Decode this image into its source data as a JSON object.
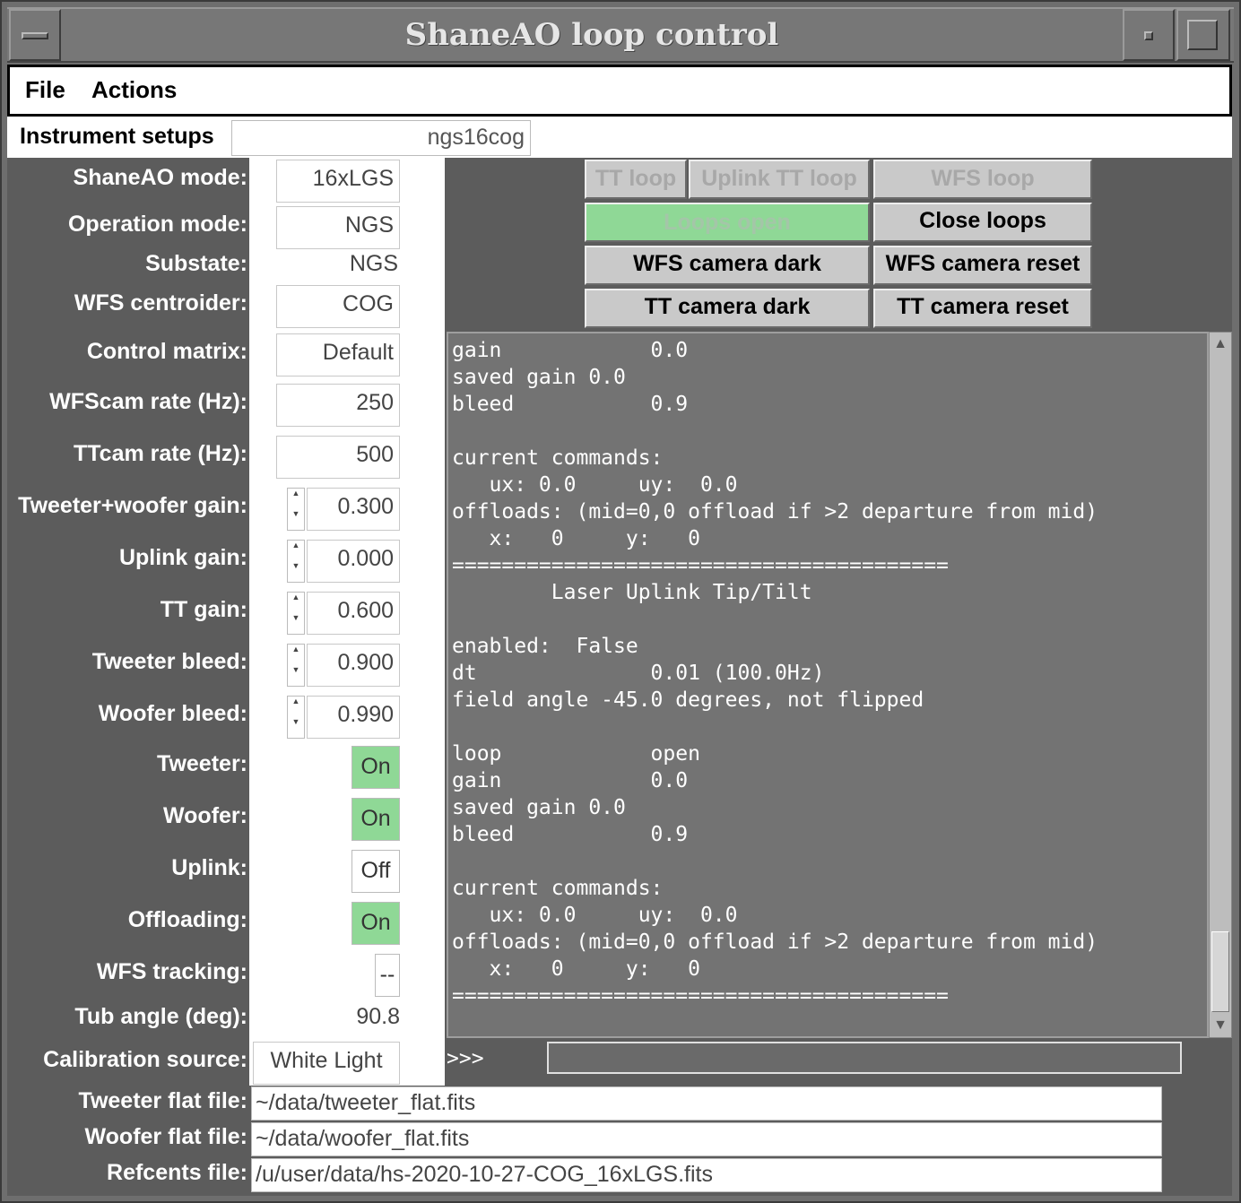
{
  "window": {
    "title": "ShaneAO loop control"
  },
  "menu": {
    "file": "File",
    "actions": "Actions"
  },
  "setups": {
    "label": "Instrument setups",
    "value": "ngs16cog"
  },
  "params": {
    "shaneao_mode": {
      "label": "ShaneAO mode:",
      "value": "16xLGS"
    },
    "operation_mode": {
      "label": "Operation mode:",
      "value": "NGS"
    },
    "substate": {
      "label": "Substate:",
      "value": "NGS"
    },
    "wfs_centroider": {
      "label": "WFS centroider:",
      "value": "COG"
    },
    "control_matrix": {
      "label": "Control matrix:",
      "value": "Default"
    },
    "wfscam_rate": {
      "label": "WFScam rate (Hz):",
      "value": "250"
    },
    "ttcam_rate": {
      "label": "TTcam rate (Hz):",
      "value": "500"
    },
    "tw_gain": {
      "label": "Tweeter+woofer gain:",
      "value": "0.300"
    },
    "uplink_gain": {
      "label": "Uplink gain:",
      "value": "0.000"
    },
    "tt_gain": {
      "label": "TT gain:",
      "value": "0.600"
    },
    "tweeter_bleed": {
      "label": "Tweeter bleed:",
      "value": "0.900"
    },
    "woofer_bleed": {
      "label": "Woofer bleed:",
      "value": "0.990"
    },
    "tweeter": {
      "label": "Tweeter:",
      "value": "On",
      "state": "on"
    },
    "woofer": {
      "label": "Woofer:",
      "value": "On",
      "state": "on"
    },
    "uplink": {
      "label": "Uplink:",
      "value": "Off",
      "state": "off"
    },
    "offloading": {
      "label": "Offloading:",
      "value": "On",
      "state": "on"
    },
    "wfs_tracking": {
      "label": "WFS tracking:",
      "value": "--"
    },
    "tub_angle": {
      "label": "Tub angle (deg):",
      "value": "90.8"
    },
    "cal_source": {
      "label": "Calibration source:",
      "value": "White Light"
    }
  },
  "buttons": {
    "tt_loop": "TT loop",
    "uplink_tt_loop": "Uplink TT loop",
    "wfs_loop": "WFS loop",
    "loops_open": "Loops open",
    "close_loops": "Close loops",
    "wfs_cam_dark": "WFS camera dark",
    "wfs_cam_reset": "WFS camera reset",
    "tt_cam_dark": "TT camera dark",
    "tt_cam_reset": "TT camera reset"
  },
  "console": {
    "lines": "gain            0.0\nsaved gain 0.0\nbleed           0.9\n\ncurrent commands:\n   ux: 0.0     uy:  0.0\noffloads: (mid=0,0 offload if >2 departure from mid)\n   x:   0     y:   0\n========================================\n        Laser Uplink Tip/Tilt\n\nenabled:  False\ndt              0.01 (100.0Hz)\nfield angle -45.0 degrees, not flipped\n\nloop            open\ngain            0.0\nsaved gain 0.0\nbleed           0.9\n\ncurrent commands:\n   ux: 0.0     uy:  0.0\noffloads: (mid=0,0 offload if >2 departure from mid)\n   x:   0     y:   0\n========================================",
    "prompt": ">>>"
  },
  "files": {
    "tweeter_flat": {
      "label": "Tweeter flat file:",
      "value": "~/data/tweeter_flat.fits"
    },
    "woofer_flat": {
      "label": "Woofer flat file:",
      "value": "~/data/woofer_flat.fits"
    },
    "refcents": {
      "label": "Refcents file:",
      "value": "/u/user/data/hs-2020-10-27-COG_16xLGS.fits"
    }
  },
  "colors": {
    "on_green": "#8fd896",
    "panel_gray": "#5c5c5c",
    "console_bg": "#737373"
  }
}
